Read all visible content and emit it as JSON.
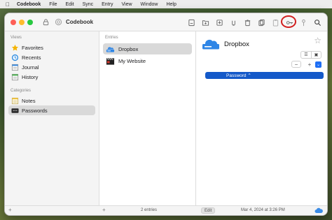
{
  "menubar": {
    "apple": "",
    "items": [
      "Codebook",
      "File",
      "Edit",
      "Sync",
      "Entry",
      "View",
      "Window",
      "Help"
    ]
  },
  "window": {
    "title": "Codebook"
  },
  "sidebar": {
    "views_label": "Views",
    "views": [
      {
        "label": "Favorites",
        "icon": "star-icon"
      },
      {
        "label": "Recents",
        "icon": "recents-icon"
      },
      {
        "label": "Journal",
        "icon": "journal-icon"
      },
      {
        "label": "History",
        "icon": "history-icon"
      }
    ],
    "categories_label": "Categories",
    "categories": [
      {
        "label": "Notes",
        "icon": "notes-icon"
      },
      {
        "label": "Passwords",
        "icon": "passwords-icon",
        "selected": true
      }
    ]
  },
  "entries": {
    "label": "Entries",
    "items": [
      {
        "label": "Dropbox",
        "icon": "dropbox-drive-icon",
        "selected": true
      },
      {
        "label": "My Website",
        "icon": "clapperboard-icon"
      }
    ]
  },
  "detail": {
    "title": "Dropbox",
    "field_label": "Password ⌃"
  },
  "bottombar": {
    "add": "+",
    "count": "2 entries",
    "edit": "Edit",
    "date": "Mar 4, 2024 at 3:26 PM"
  },
  "colors": {
    "accent": "#1459c9",
    "highlight_ring": "#d11f1f",
    "selection": "#d9d9d9"
  }
}
